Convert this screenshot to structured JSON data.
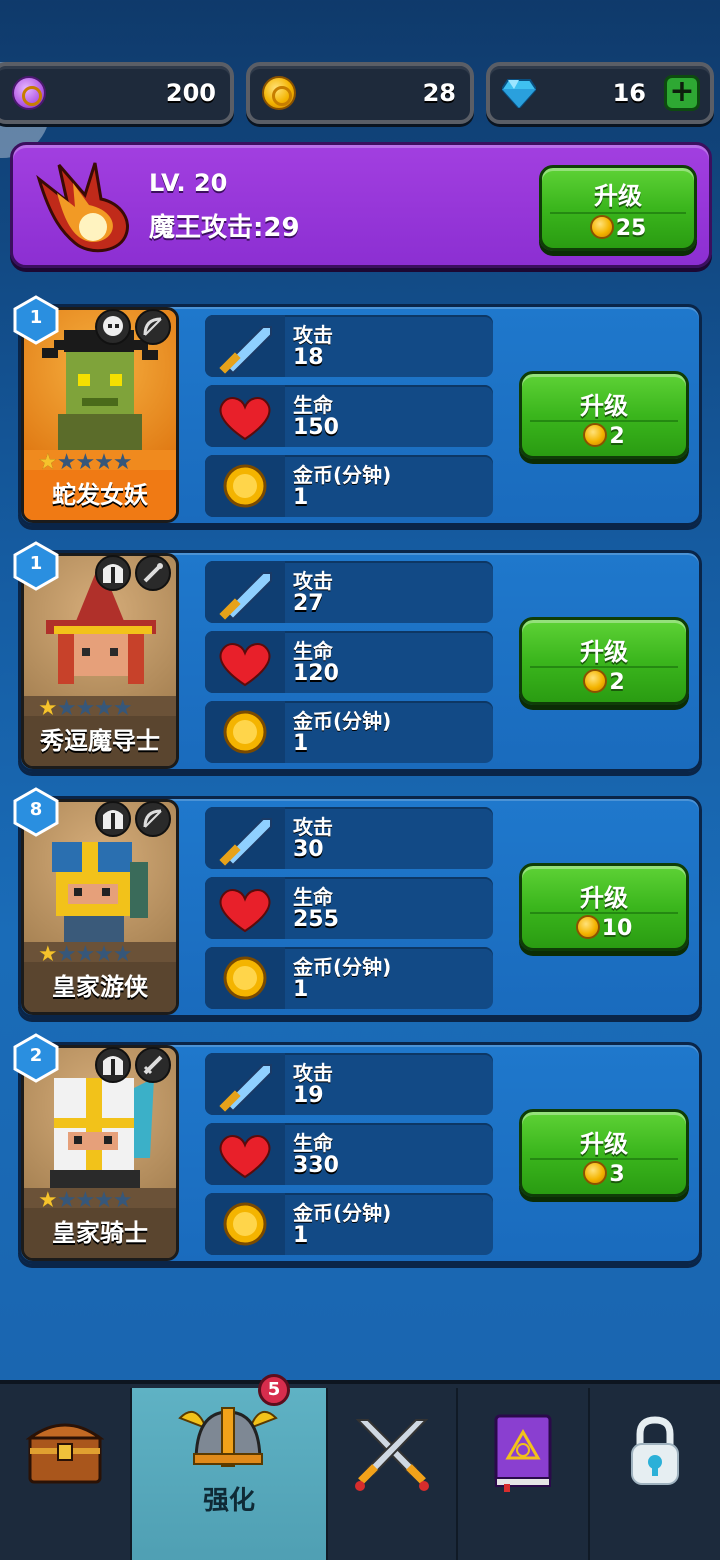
{
  "currency": {
    "purple_value": "200",
    "gold_value": "28",
    "gem_value": "16",
    "plus_label": "+"
  },
  "boss": {
    "level": "LV. 20",
    "attack_label": "魔王攻击:29",
    "upgrade_label": "升级",
    "upgrade_cost": "25"
  },
  "heroes": [
    {
      "level": "1",
      "name": "蛇发女妖",
      "stars": 1,
      "card_color": "#f08a1e",
      "attack_label": "攻击",
      "attack": "18",
      "hp_label": "生命",
      "hp": "150",
      "gold_label": "金币(分钟)",
      "gold": "1",
      "upgrade_label": "升级",
      "upgrade_cost": "2"
    },
    {
      "level": "1",
      "name": "秀逗魔导士",
      "stars": 1,
      "card_color": "#6b5238",
      "attack_label": "攻击",
      "attack": "27",
      "hp_label": "生命",
      "hp": "120",
      "gold_label": "金币(分钟)",
      "gold": "1",
      "upgrade_label": "升级",
      "upgrade_cost": "2"
    },
    {
      "level": "8",
      "name": "皇家游侠",
      "stars": 1,
      "card_color": "#6b5238",
      "attack_label": "攻击",
      "attack": "30",
      "hp_label": "生命",
      "hp": "255",
      "gold_label": "金币(分钟)",
      "gold": "1",
      "upgrade_label": "升级",
      "upgrade_cost": "10"
    },
    {
      "level": "2",
      "name": "皇家骑士",
      "stars": 1,
      "card_color": "#6b5238",
      "attack_label": "攻击",
      "attack": "19",
      "hp_label": "生命",
      "hp": "330",
      "gold_label": "金币(分钟)",
      "gold": "1",
      "upgrade_label": "升级",
      "upgrade_cost": "3"
    }
  ],
  "nav": {
    "items": [
      {
        "icon": "treasure-chest-icon"
      },
      {
        "icon": "viking-helmet-icon",
        "label": "强化",
        "badge": "5"
      },
      {
        "icon": "crossed-swords-icon"
      },
      {
        "icon": "spellbook-icon"
      },
      {
        "icon": "lock-icon"
      }
    ]
  },
  "colors": {
    "boss_panel": "#9b3bdc",
    "green_button": "#3bb61d",
    "hero_row": "#1f78cc",
    "nav_active": "#5fb2c4"
  }
}
